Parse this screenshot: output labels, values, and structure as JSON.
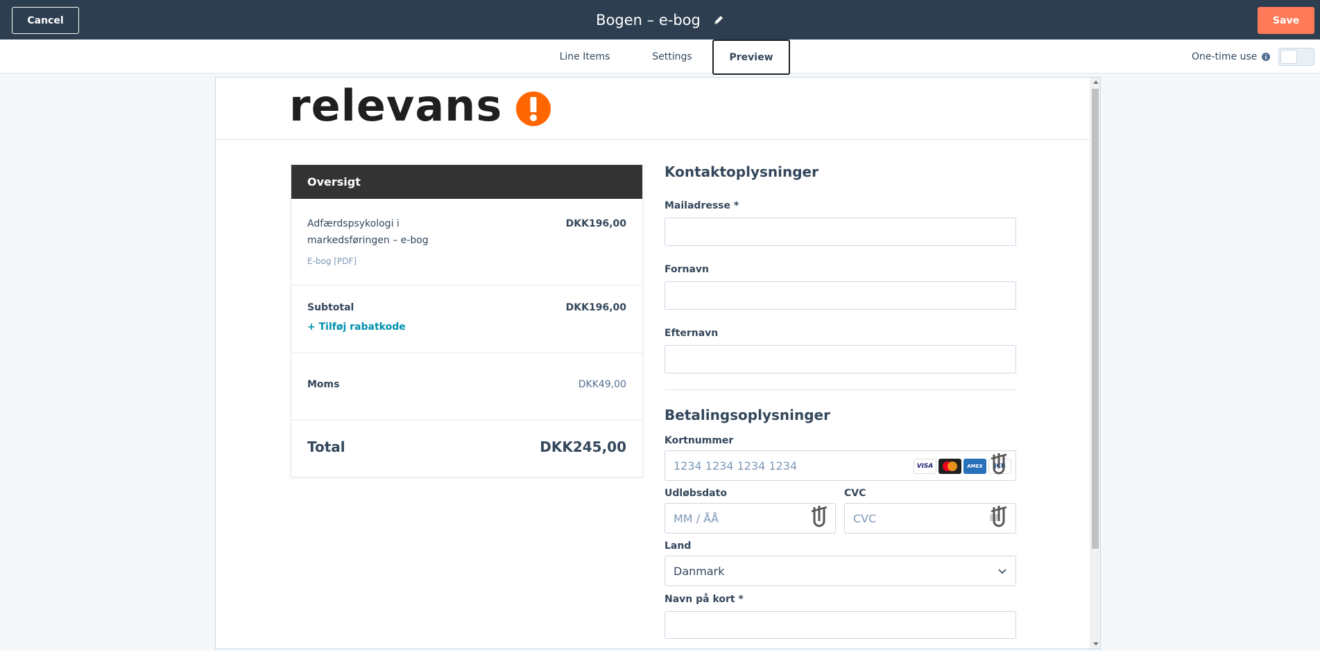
{
  "header": {
    "cancel_label": "Cancel",
    "title": "Bogen – e-bog",
    "save_label": "Save",
    "edit_icon": "pencil-icon"
  },
  "tabs": [
    {
      "label": "Line Items"
    },
    {
      "label": "Settings"
    },
    {
      "label": "Preview",
      "active": true
    }
  ],
  "one_time": {
    "label": "One-time use",
    "info_icon": "info-icon",
    "enabled": false
  },
  "brand": {
    "logo_text": "relevans",
    "accent": "#ff6600"
  },
  "colors": {
    "header_bg": "#2d3e50",
    "save": "#ff7a59",
    "link": "#0091ae",
    "summary_head": "#333333"
  },
  "summary": {
    "title": "Oversigt",
    "item": {
      "name": "Adfærdspsykologi i markedsføringen – e-bog",
      "price": "DKK196,00",
      "variant": "E-bog [PDF]"
    },
    "subtotal_label": "Subtotal",
    "subtotal_value": "DKK196,00",
    "discount_link": "+ Tilføj rabatkode",
    "moms_label": "Moms",
    "moms_value": "DKK49,00",
    "total_label": "Total",
    "total_value": "DKK245,00"
  },
  "contact": {
    "heading": "Kontaktoplysninger",
    "email_label": "Mailadresse *",
    "firstname_label": "Fornavn",
    "lastname_label": "Efternavn"
  },
  "payment": {
    "heading": "Betalingsoplysninger",
    "card_label": "Kortnummer",
    "card_placeholder": "1234 1234 1234 1234",
    "card_brands": [
      "VISA",
      "Mastercard",
      "AMEX",
      "JCB"
    ],
    "expiry_label": "Udløbsdato",
    "expiry_placeholder": "MM / ÅÅ",
    "cvc_label": "CVC",
    "cvc_placeholder": "CVC",
    "country_label": "Land",
    "country_value": "Danmark",
    "name_label": "Navn på kort *"
  }
}
